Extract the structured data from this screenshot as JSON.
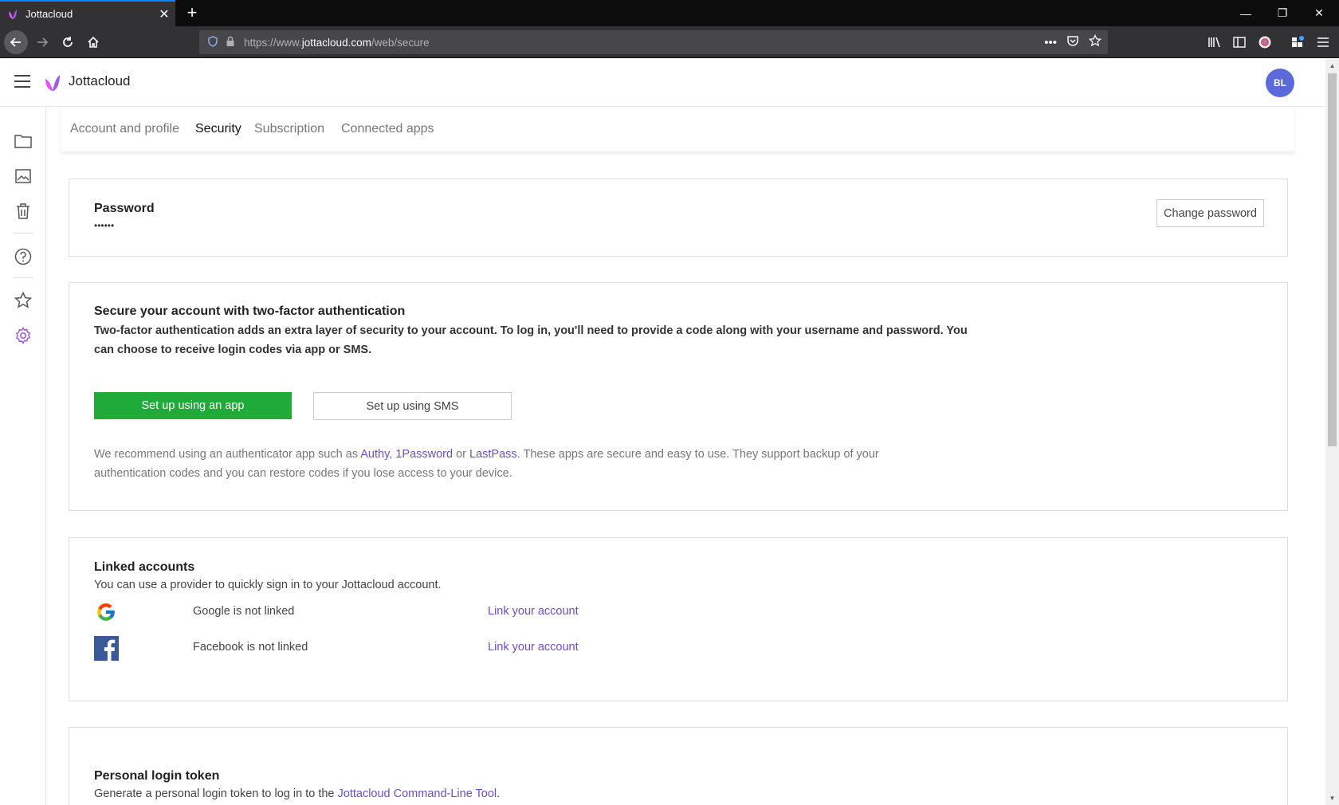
{
  "browser": {
    "tab_title": "Jottacloud",
    "tab_close": "✕",
    "new_tab": "+",
    "url_prefix": "https://www.",
    "url_host": "jottacloud.com",
    "url_path": "/web/secure",
    "url_more": "•••",
    "minimize": "—",
    "restore": "❐",
    "close": "✕"
  },
  "header": {
    "brand": "Jottacloud",
    "avatar_initials": "BL"
  },
  "tabs": [
    {
      "label": "Account and profile",
      "active": false
    },
    {
      "label": "Security",
      "active": true
    },
    {
      "label": "Subscription",
      "active": false
    },
    {
      "label": "Connected apps",
      "active": false
    }
  ],
  "password": {
    "title": "Password",
    "masked": "••••••",
    "change_label": "Change password"
  },
  "two_factor": {
    "title": "Secure your account with two-factor authentication",
    "description": "Two-factor authentication adds an extra layer of security to your account. To log in, you'll need to provide a code along with your username and password. You can choose to receive login codes via app or SMS.",
    "app_button": "Set up using an app",
    "sms_button": "Set up using SMS",
    "recommend_prefix": "We recommend using an authenticator app such as ",
    "app1": "Authy",
    "sep1": ", ",
    "app2": "1Password",
    "sep2": " or ",
    "app3": "LastPass",
    "recommend_suffix": ". These apps are secure and easy to use. They support backup of your authentication codes and you can restore codes if you lose access to your device."
  },
  "linked": {
    "title": "Linked accounts",
    "subtitle": "You can use a provider to quickly sign in to your Jottacloud account.",
    "google_status": "Google is not linked",
    "google_link": "Link your account",
    "facebook_status": "Facebook is not linked",
    "facebook_link": "Link your account"
  },
  "token": {
    "title": "Personal login token",
    "text_prefix": "Generate a personal login token to log in to the ",
    "link": "Jottacloud Command-Line Tool",
    "text_suffix": "."
  },
  "colors": {
    "accent": "#1faa3a",
    "link": "#6a4fc7",
    "avatar": "#5b6ad8",
    "settings_icon": "#a259e6"
  }
}
